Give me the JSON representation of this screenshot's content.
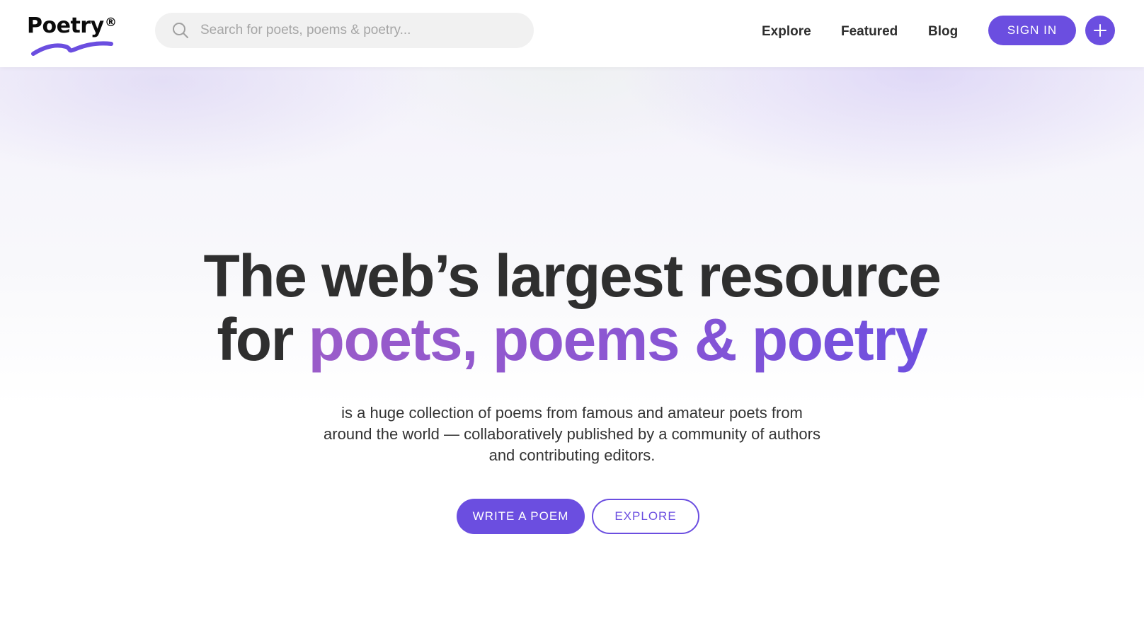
{
  "header": {
    "logo_text": "Poetry",
    "logo_mark": "®",
    "search": {
      "placeholder": "Search for poets, poems & poetry...",
      "value": "",
      "icon": "search-icon"
    },
    "nav": [
      {
        "label": "Explore"
      },
      {
        "label": "Featured"
      },
      {
        "label": "Blog"
      }
    ],
    "sign_in_label": "SIGN IN",
    "add_icon": "plus-icon"
  },
  "hero": {
    "headline_line1": "The web’s largest resource",
    "headline_line2_prefix": "for ",
    "headline_line2_accent": "poets, poems & poetry",
    "description": "is a huge collection of poems from famous and amateur poets from around the world — collaboratively published by a community of authors and contributing editors.",
    "primary_button": "WRITE A POEM",
    "secondary_button": "EXPLORE"
  },
  "colors": {
    "accent": "#6b4ee0",
    "headline_gradient_start": "#9a5cc9",
    "headline_gradient_end": "#6e4fe0",
    "text": "#2f2f2f",
    "search_bg": "#f1f1f1"
  }
}
